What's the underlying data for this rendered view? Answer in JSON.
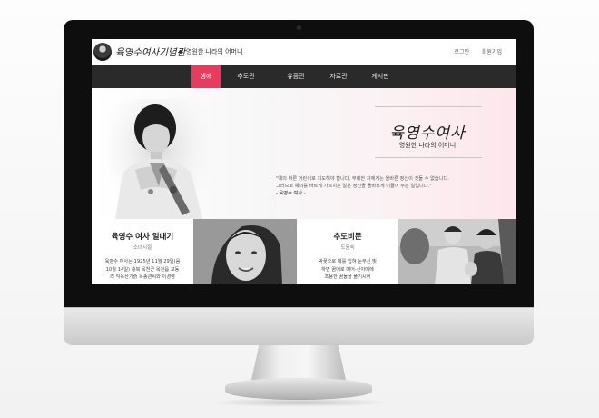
{
  "header": {
    "site_title": "육영수여사기념관",
    "site_subtitle": "영원한 나라의 어머니",
    "links": [
      "로그인",
      "회원가입"
    ]
  },
  "nav": {
    "items": [
      "생애",
      "추도관",
      "유품관",
      "자료관",
      "게시판"
    ],
    "active_index": 0,
    "active_color": "#e73c5d"
  },
  "hero": {
    "name": "육영수여사",
    "subname": "영원한 나라의 어머니",
    "quote_lines": [
      "\"예의 바른 어린이로 지도해야 합니다. 무례한 자에게는 올바른 정신이 깃들 수 없습니다.",
      "그러므로 예의를 바르게 가르치는 일은 정신을 올바르게 이끌어 주는 일입니다.\""
    ],
    "quote_author": "- 육영수 여사 -"
  },
  "cards": [
    {
      "title": "육영수 여사 일대기",
      "subtitle": "소녀시절",
      "body": [
        "육영수 여사는 1925년 11월 29일(음",
        "10월 14일) 충북 옥천군 옥천읍 교동",
        "리 익육산기슭 옥종관씨와 이경령"
      ]
    },
    {
      "title": "추도비문",
      "subtitle": "도윤숙",
      "body": [
        "박꽃으로 떼를 입혀 눈부신 빛",
        "하면 꿈에로 떠어-신아메에",
        "조용한 꿈들을 풀기시어"
      ]
    }
  ],
  "icons": {
    "logo": "portrait-avatar-icon"
  }
}
